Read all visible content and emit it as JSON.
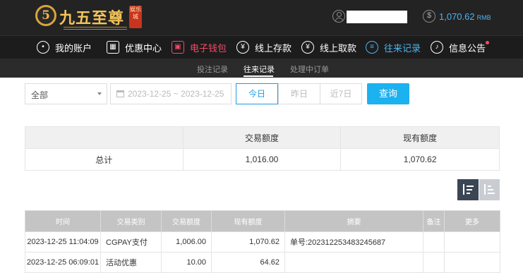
{
  "brand": {
    "badge": "5",
    "name": "九五至尊",
    "tag": "娱乐城"
  },
  "account": {
    "balance": "1,070.62",
    "currency": "RMB"
  },
  "nav": [
    {
      "label": "我的账户",
      "icon": "person-icon"
    },
    {
      "label": "优惠中心",
      "icon": "gift-icon"
    },
    {
      "label": "电子钱包",
      "icon": "wallet-icon"
    },
    {
      "label": "线上存款",
      "icon": "deposit-icon"
    },
    {
      "label": "线上取款",
      "icon": "withdraw-icon"
    },
    {
      "label": "往来记录",
      "icon": "records-icon"
    },
    {
      "label": "信息公告",
      "icon": "bell-icon"
    }
  ],
  "subnav": [
    "投注记录",
    "往来记录",
    "处理中订单"
  ],
  "filters": {
    "type_select": "全部",
    "date_range": "2023-12-25 ~ 2023-12-25",
    "quick": [
      "今日",
      "昨日",
      "近7日"
    ],
    "search_label": "查询"
  },
  "summary": {
    "headers": [
      "交易额度",
      "现有额度"
    ],
    "row_label": "总计",
    "total_amount": "1,016.00",
    "current_amount": "1,070.62"
  },
  "records": {
    "headers": [
      "时间",
      "交易类别",
      "交易额度",
      "现有额度",
      "摘要",
      "备注",
      "更多"
    ],
    "rows": [
      [
        "2023-12-25 11:04:09",
        "CGPAY支付",
        "1,006.00",
        "1,070.62",
        "单号:202312253483245687",
        "",
        ""
      ],
      [
        "2023-12-25 06:09:01",
        "活动优惠",
        "10.00",
        "64.62",
        "",
        "",
        ""
      ]
    ]
  },
  "colors": {
    "accent": "#1cb1ef",
    "balance": "#4fb3f2",
    "wallet_red": "#f34a6a",
    "topbar": "#232323"
  }
}
